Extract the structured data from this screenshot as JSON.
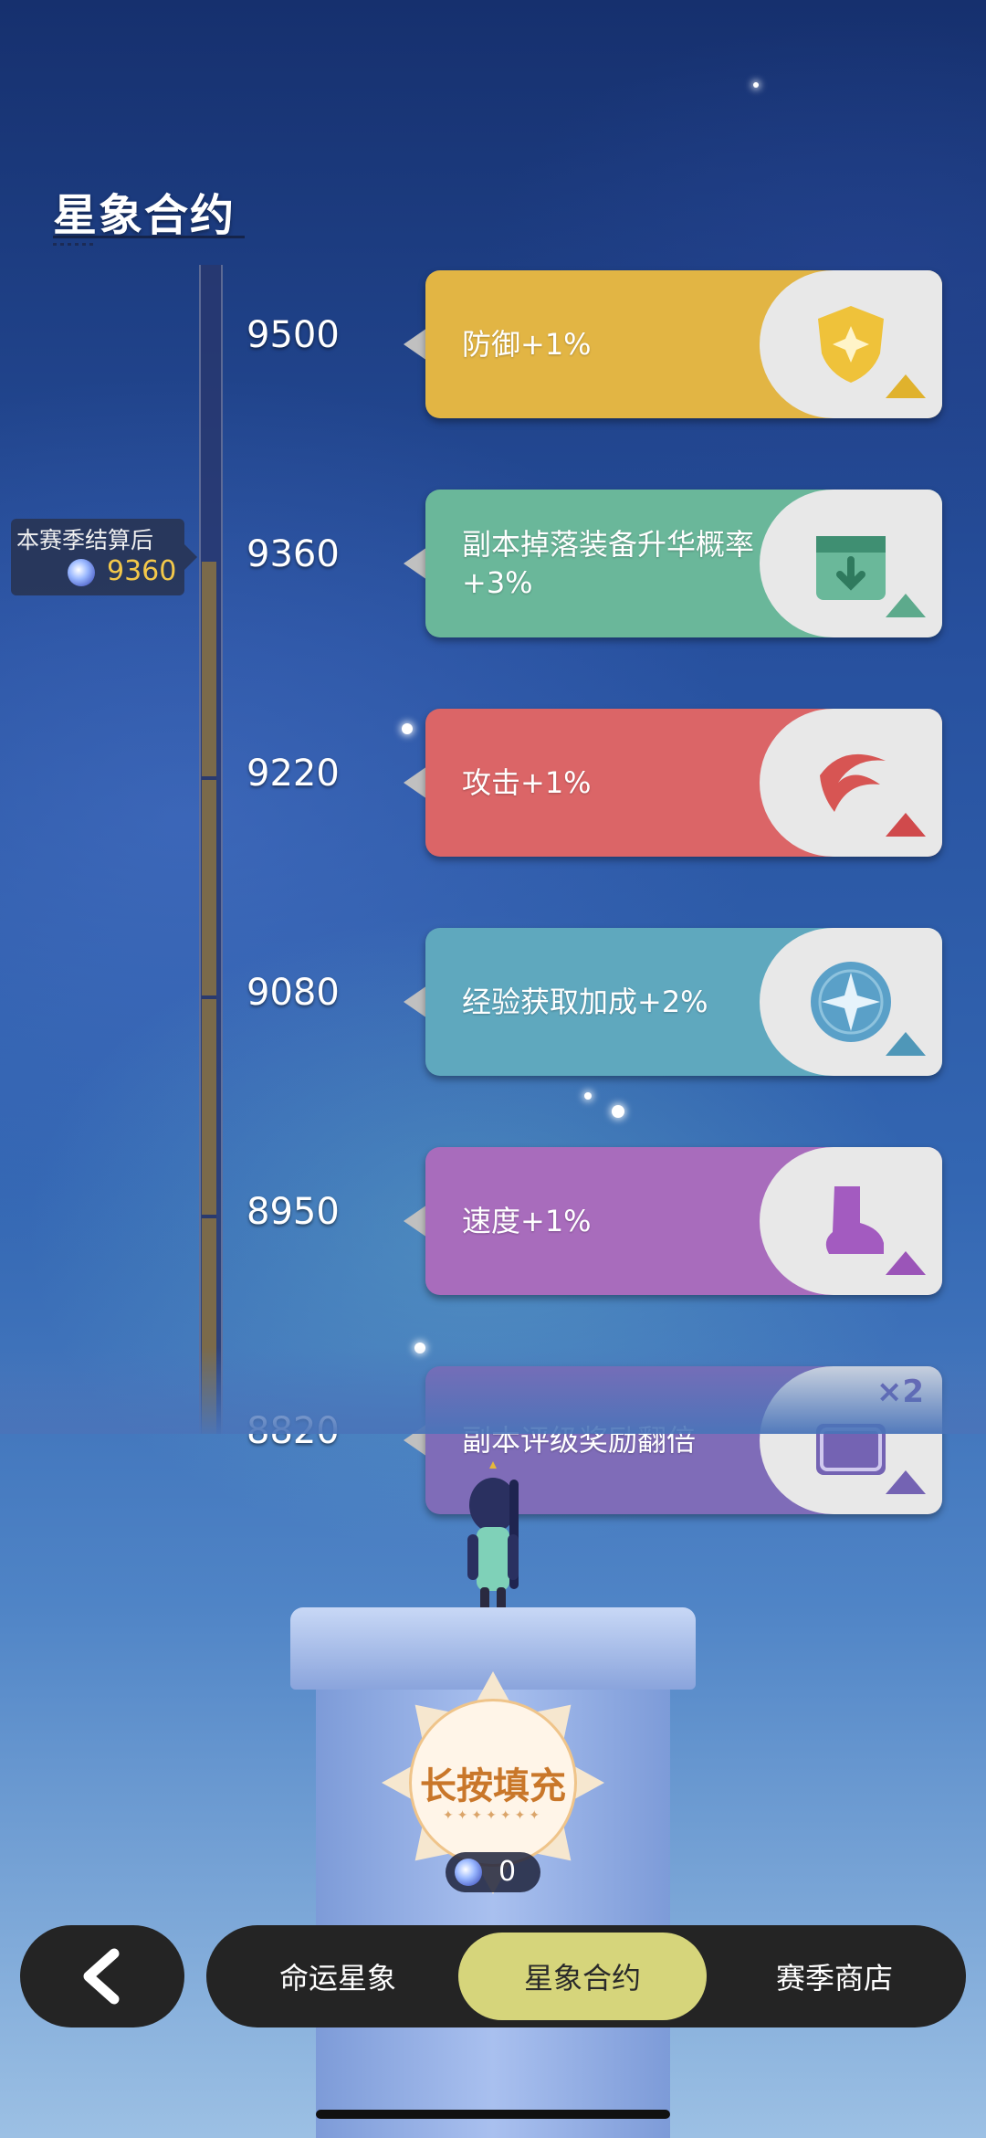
{
  "page": {
    "title": "星象合约"
  },
  "season_badge": {
    "label": "本赛季结算后",
    "value": "9360"
  },
  "rewards": [
    {
      "level": "9500",
      "text": "防御+1%",
      "color": "#e2b544",
      "icon": "shield-icon",
      "icon_color": "#efc23a",
      "arrow_color": "#e0b22d"
    },
    {
      "level": "9360",
      "text": "副本掉落装备升华概率+3%",
      "color": "#6ab79a",
      "icon": "box-download-icon",
      "icon_color": "#6ab89a",
      "arrow_color": "#5daa8c"
    },
    {
      "level": "9220",
      "text": "攻击+1%",
      "color": "#db6567",
      "icon": "slash-attack-icon",
      "icon_color": "#d75553",
      "arrow_color": "#d04a4c"
    },
    {
      "level": "9080",
      "text": "经验获取加成+2%",
      "color": "#5fa8be",
      "icon": "compass-star-icon",
      "icon_color": "#5aa0c8",
      "arrow_color": "#4f97b8"
    },
    {
      "level": "8950",
      "text": "速度+1%",
      "color": "#a86cbc",
      "icon": "boot-icon",
      "icon_color": "#a35bc0",
      "arrow_color": "#9b55b8"
    },
    {
      "level": "8820",
      "text": "副本评级奖励翻倍",
      "color": "#7f6cb8",
      "icon": "chest-double-icon",
      "icon_color": "#7463b3",
      "arrow_color": "#7463b3",
      "badge": "×2"
    }
  ],
  "fill_button": {
    "label": "长按填充",
    "orb_count": "0"
  },
  "nav": {
    "back_icon": "back-arrow-icon",
    "tabs": [
      {
        "label": "命运星象",
        "active": false
      },
      {
        "label": "星象合约",
        "active": true
      },
      {
        "label": "赛季商店",
        "active": false
      }
    ]
  },
  "colors": {
    "active_tab": "#d6d57b",
    "tabbar_bg": "#242424",
    "season_value": "#f3c84a"
  }
}
